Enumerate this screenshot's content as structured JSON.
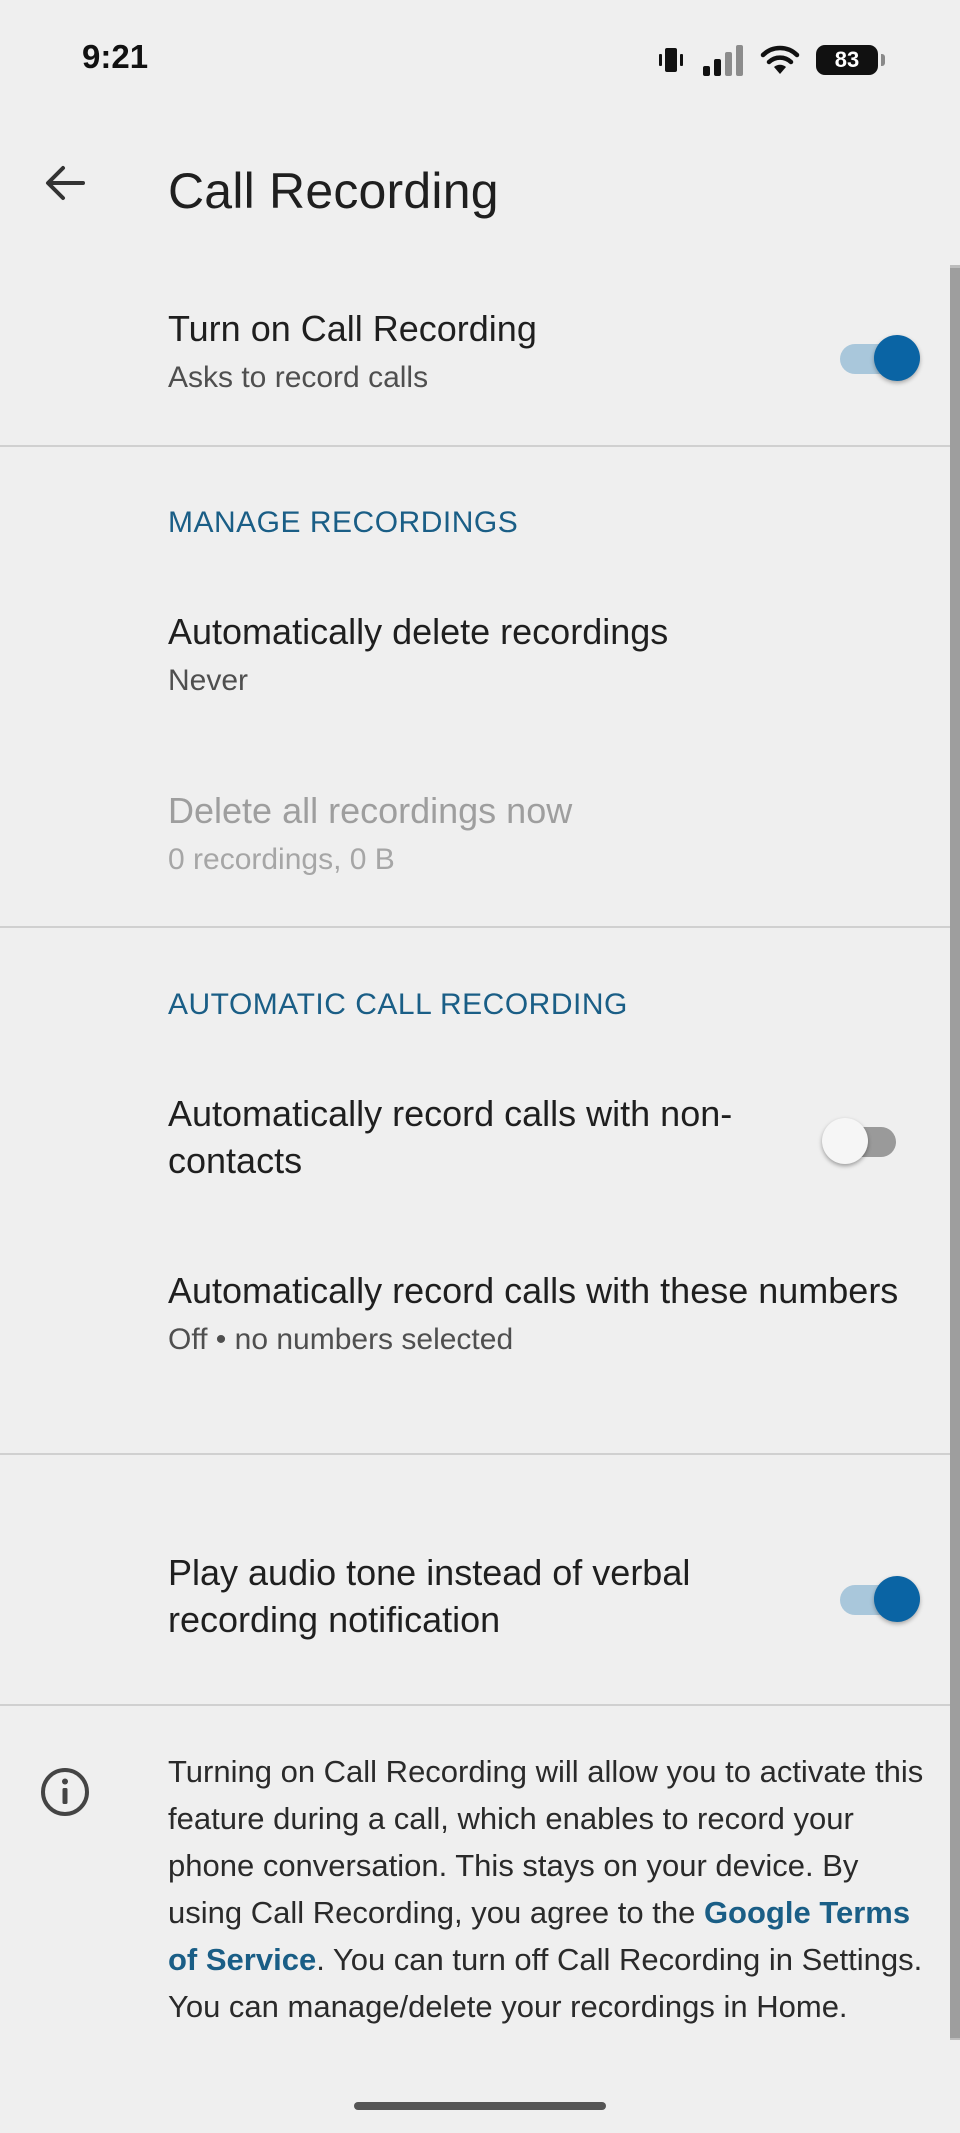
{
  "status_bar": {
    "time": "9:21",
    "battery": "83",
    "icons": [
      "vibrate-icon",
      "signal-icon",
      "wifi-icon",
      "battery-icon"
    ]
  },
  "app_bar": {
    "back_icon": "arrow-back-icon",
    "title": "Call Recording"
  },
  "main_toggle": {
    "title": "Turn on Call Recording",
    "subtitle": "Asks to record calls",
    "enabled": true
  },
  "manage_recordings": {
    "header": "MANAGE RECORDINGS",
    "auto_delete": {
      "title": "Automatically delete recordings",
      "subtitle": "Never"
    },
    "delete_all": {
      "title": "Delete all recordings now",
      "subtitle": "0 recordings, 0 B",
      "disabled": true
    }
  },
  "automatic_call_recording": {
    "header": "AUTOMATIC CALL RECORDING",
    "non_contacts": {
      "title": "Automatically record calls with non-contacts",
      "enabled": false
    },
    "these_numbers": {
      "title": "Automatically record calls with these numbers",
      "subtitle": "Off • no numbers selected"
    }
  },
  "audio_tone": {
    "title": "Play audio tone instead of verbal recording notification",
    "enabled": true
  },
  "info": {
    "icon": "info-icon",
    "text_before_link": "Turning on Call Recording will allow you to activate this feature during a call, which enables to record your phone conversation. This stays on your device. By using Call Recording, you agree to the ",
    "link_text": "Google Terms of Service",
    "text_after_link": ". You can turn off Call Recording in Settings. You can manage/delete your recordings in Home."
  },
  "colors": {
    "accent": "#0a64a4",
    "section_header": "#1a5e86",
    "background": "#efefef"
  }
}
